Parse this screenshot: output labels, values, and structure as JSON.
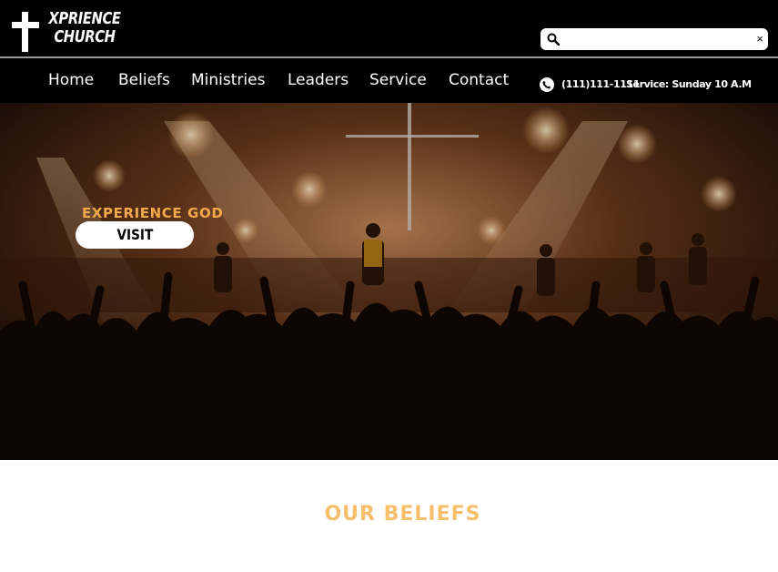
{
  "brand": {
    "logo_line1": "XPRIENCE",
    "logo_line2": "CHURCH",
    "logo_icon": "cross-icon"
  },
  "search": {
    "value": "",
    "placeholder": "",
    "icon": "search-icon",
    "clear_label": "×"
  },
  "nav": {
    "items": [
      {
        "label": "Home"
      },
      {
        "label": "Beliefs"
      },
      {
        "label": "Ministries"
      },
      {
        "label": "Leaders"
      },
      {
        "label": "Service"
      },
      {
        "label": "Contact"
      }
    ]
  },
  "contact": {
    "phone_icon": "phone-icon",
    "phone": "(111)111-1111",
    "service_time": "Service: Sunday 10 A.M"
  },
  "hero": {
    "tagline": "EXPERIENCE GOD",
    "button_label": "VISIT"
  },
  "sections": {
    "beliefs_title": "OUR BELIEFS"
  },
  "colors": {
    "accent": "#f2a94a",
    "header_bg": "#000000",
    "section_title": "#f7bf6b"
  }
}
